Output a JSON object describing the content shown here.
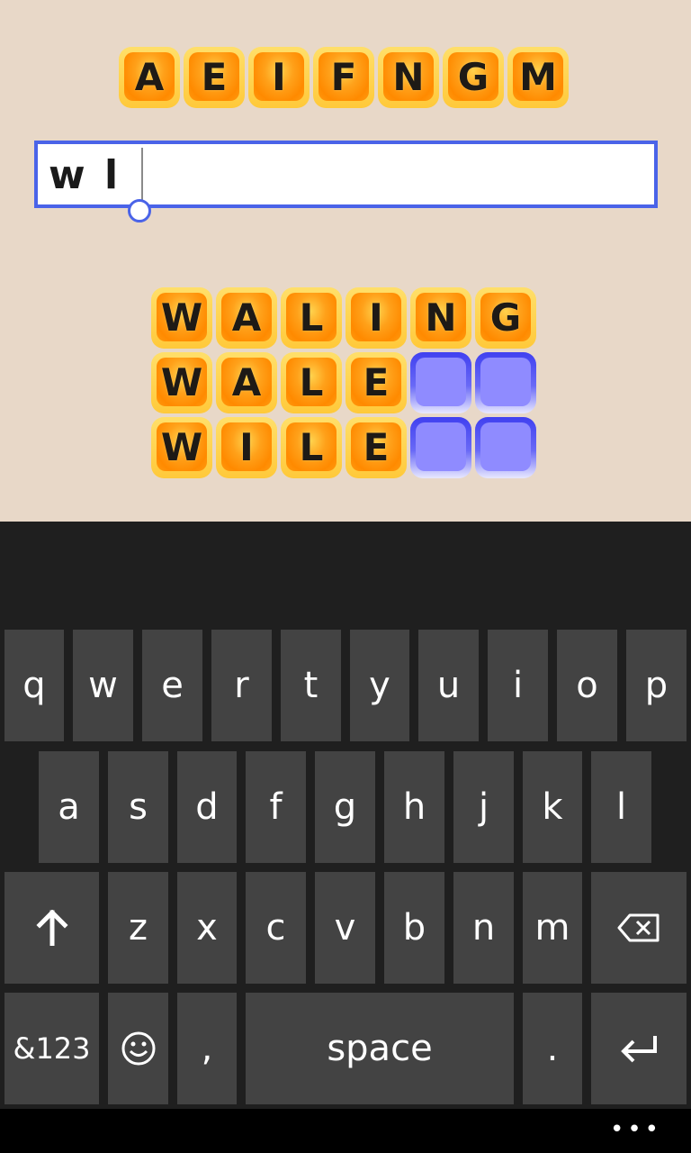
{
  "rack": [
    "A",
    "E",
    "I",
    "F",
    "N",
    "G",
    "M"
  ],
  "input": {
    "value": "w l"
  },
  "words": [
    [
      "W",
      "A",
      "L",
      "I",
      "N",
      "G"
    ],
    [
      "W",
      "A",
      "L",
      "E",
      "",
      ""
    ],
    [
      "W",
      "I",
      "L",
      "E",
      "",
      ""
    ]
  ],
  "keyboard": {
    "row1": [
      "q",
      "w",
      "e",
      "r",
      "t",
      "y",
      "u",
      "i",
      "o",
      "p"
    ],
    "row2": [
      "a",
      "s",
      "d",
      "f",
      "g",
      "h",
      "j",
      "k",
      "l"
    ],
    "row3": [
      "z",
      "x",
      "c",
      "v",
      "b",
      "n",
      "m"
    ],
    "numbers_label": "&123",
    "comma_label": ",",
    "space_label": "space",
    "period_label": ".",
    "shift_icon": "shift-arrow-up-icon",
    "backspace_icon": "backspace-icon",
    "emoji_icon": "smiley-icon",
    "enter_icon": "enter-return-icon"
  },
  "appbar": {
    "more_label": "•••"
  },
  "colors": {
    "background": "#e8d8c8",
    "tile_orange": "#ff8a00",
    "tile_empty": "#8f8bff",
    "input_border": "#4a63e8",
    "key": "#434343",
    "keyboard_bg": "#1f1f1f"
  }
}
